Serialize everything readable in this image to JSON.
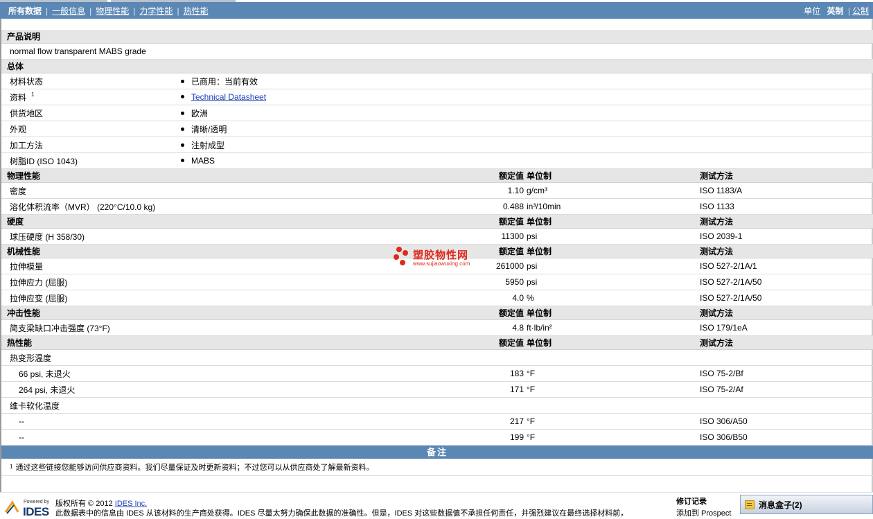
{
  "nav": {
    "tabs": [
      "所有数据",
      "一般信息",
      "物理性能",
      "力学性能",
      "热性能"
    ],
    "units_label": "单位",
    "units_active": "英制",
    "units_other": "公制"
  },
  "product": {
    "section": "产品说明",
    "description": "normal flow transparent MABS grade"
  },
  "general": {
    "section": "总体",
    "rows": [
      {
        "label": "材料状态",
        "value": "已商用：当前有效"
      },
      {
        "label": "资料",
        "sup": "1",
        "value": "Technical Datasheet",
        "link": true
      },
      {
        "label": "供货地区",
        "value": "欧洲"
      },
      {
        "label": "外观",
        "value": "清晰/透明"
      },
      {
        "label": "加工方法",
        "value": "注射成型"
      },
      {
        "label": "树脂ID (ISO 1043)",
        "value": "MABS"
      }
    ]
  },
  "headers": {
    "nominal": "额定值",
    "unit": "单位制",
    "method": "测试方法"
  },
  "physical": {
    "section": "物理性能",
    "rows": [
      {
        "label": "密度",
        "value": "1.10",
        "unit": "g/cm³",
        "method": "ISO 1183/A"
      },
      {
        "label": "溶化体积流率（MVR） (220°C/10.0 kg)",
        "value": "0.488",
        "unit": "in³/10min",
        "method": "ISO 1133"
      }
    ]
  },
  "hardness": {
    "section": "硬度",
    "rows": [
      {
        "label": "球压硬度 (H 358/30)",
        "value": "11300",
        "unit": "psi",
        "method": "ISO 2039-1"
      }
    ]
  },
  "mechanical": {
    "section": "机械性能",
    "rows": [
      {
        "label": "拉伸模量",
        "value": "261000",
        "unit": "psi",
        "method": "ISO 527-2/1A/1"
      },
      {
        "label": "拉伸应力 (屈服)",
        "value": "5950",
        "unit": "psi",
        "method": "ISO 527-2/1A/50"
      },
      {
        "label": "拉伸应变 (屈服)",
        "value": "4.0",
        "unit": "%",
        "method": "ISO 527-2/1A/50"
      }
    ]
  },
  "impact": {
    "section": "冲击性能",
    "rows": [
      {
        "label": "简支梁缺口冲击强度 (73°F)",
        "value": "4.8",
        "unit": "ft·lb/in²",
        "method": "ISO 179/1eA"
      }
    ]
  },
  "thermal": {
    "section": "热性能",
    "rows": [
      {
        "label": "热变形温度",
        "value": "",
        "unit": "",
        "method": "",
        "group": true
      },
      {
        "label": "66 psi, 未退火",
        "value": "183",
        "unit": "°F",
        "method": "ISO 75-2/Bf",
        "indent": true
      },
      {
        "label": "264 psi, 未退火",
        "value": "171",
        "unit": "°F",
        "method": "ISO 75-2/Af",
        "indent": true
      },
      {
        "label": "维卡软化温度",
        "value": "",
        "unit": "",
        "method": "",
        "group": true
      },
      {
        "label": "--",
        "value": "217",
        "unit": "°F",
        "method": "ISO 306/A50",
        "indent": true
      },
      {
        "label": "--",
        "value": "199",
        "unit": "°F",
        "method": "ISO 306/B50",
        "indent": true
      }
    ]
  },
  "notes": {
    "title": "备注",
    "footnote_num": "1",
    "footnote": "通过这些链接您能够访问供应商资料。我们尽量保证及时更新资料；不过您可以从供应商处了解最新资料。"
  },
  "footer": {
    "logo_small": "Powered by",
    "logo_text": "IDES",
    "copyright_prefix": "版权所有 © 2012",
    "copyright_link": "IDES Inc.",
    "disclaimer": "此数据表中的信息由 IDES 从该材料的生产商处获得。IDES 尽量太努力确保此数据的准确性。但是，IDES 对这些数据值不承担任何责任，并强烈建议在最终选择材料前，",
    "revision_title": "修订记录",
    "revision_text": "添加到 Prospect"
  },
  "watermark": {
    "title": "塑胶物性网",
    "url": "www.sujiaowuxing.com"
  },
  "msgbox": {
    "label": "消息盒子(2)"
  }
}
